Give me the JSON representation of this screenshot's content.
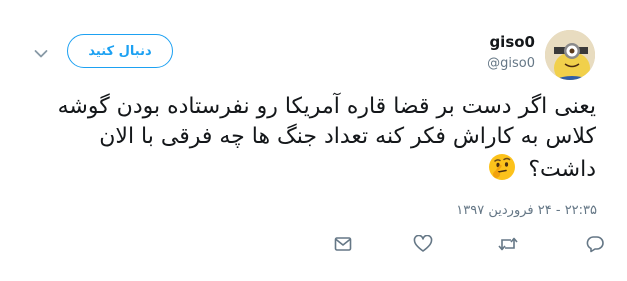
{
  "user": {
    "display_name": "giso0",
    "handle": "@giso0",
    "avatar_icon": "minion-avatar-icon"
  },
  "follow_button": {
    "label": "دنبال کنید"
  },
  "tweet": {
    "text": "یعنی اگر دست بر قضا قاره آمریکا رو نفرستاده بودن گوشه کلاس به کاراش فکر کنه تعداد جنگ ها چه فرقی با الان داشت؟",
    "emoji": "thinking-face-icon",
    "timestamp": "۲۲:۳۵ - ۲۴ فروردین ۱۳۹۷"
  },
  "actions": [
    "reply-icon",
    "retweet-icon",
    "like-icon",
    "message-icon"
  ],
  "colors": {
    "accent": "#1da1f2",
    "secondary_text": "#657786",
    "primary_text": "#14171a"
  }
}
